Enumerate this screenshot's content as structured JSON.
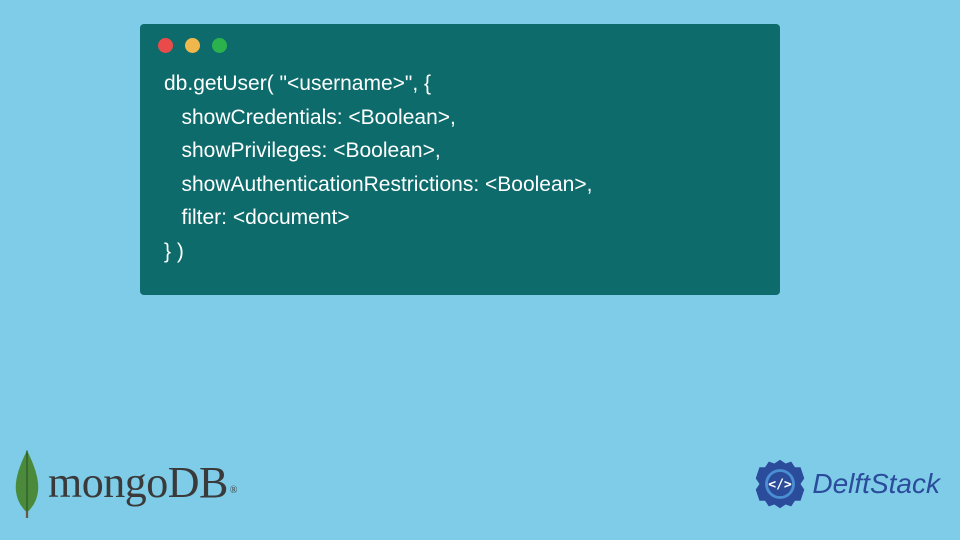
{
  "code": {
    "line1": "db.getUser( \"<username>\", {",
    "line2": "   showCredentials: <Boolean>,",
    "line3": "   showPrivileges: <Boolean>,",
    "line4": "   showAuthenticationRestrictions: <Boolean>,",
    "line5": "   filter: <document>",
    "line6": "} )"
  },
  "logos": {
    "mongodb": "mongoDB",
    "mongodb_reg": "®",
    "delftstack": "DelftStack"
  },
  "colors": {
    "background": "#7ecce8",
    "window": "#0d6b6b",
    "mongodb_leaf": "#4a8a3a",
    "delftstack_icon": "#2b4c9b"
  }
}
